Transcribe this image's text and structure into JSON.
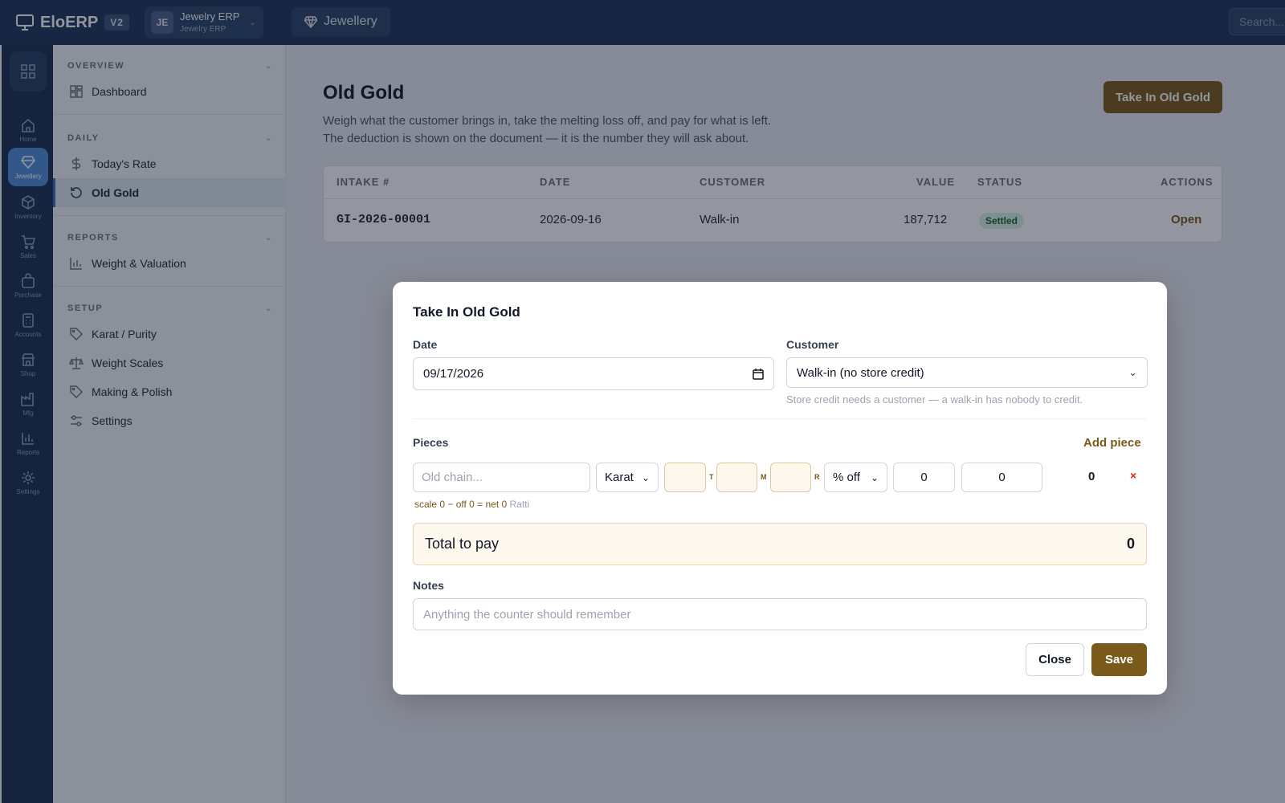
{
  "app": {
    "name": "EloERP",
    "version": "V2"
  },
  "workspace": {
    "initials": "JE",
    "name": "Jewelry ERP",
    "sub": "Jewelry ERP"
  },
  "module": {
    "label": "Jewellery"
  },
  "search": {
    "placeholder": "Search..."
  },
  "rail": {
    "items": [
      {
        "label": "Home",
        "icon": "home-icon"
      },
      {
        "label": "Jewellery",
        "icon": "diamond-icon",
        "active": true
      },
      {
        "label": "Inventory",
        "icon": "box-icon"
      },
      {
        "label": "Sales",
        "icon": "cart-icon"
      },
      {
        "label": "Purchase",
        "icon": "bag-icon"
      },
      {
        "label": "Accounts",
        "icon": "calculator-icon"
      },
      {
        "label": "Shop",
        "icon": "store-icon"
      },
      {
        "label": "Mfg",
        "icon": "factory-icon"
      },
      {
        "label": "Reports",
        "icon": "bar-chart-icon"
      },
      {
        "label": "Settings",
        "icon": "gear-icon"
      }
    ]
  },
  "sidebar": {
    "sections": [
      {
        "title": "OVERVIEW",
        "items": [
          {
            "label": "Dashboard",
            "icon": "dashboard-icon"
          }
        ]
      },
      {
        "title": "DAILY",
        "items": [
          {
            "label": "Today's Rate",
            "icon": "dollar-icon"
          },
          {
            "label": "Old Gold",
            "icon": "history-icon",
            "active": true
          }
        ]
      },
      {
        "title": "REPORTS",
        "items": [
          {
            "label": "Weight & Valuation",
            "icon": "bar-chart-icon"
          }
        ]
      },
      {
        "title": "SETUP",
        "items": [
          {
            "label": "Karat / Purity",
            "icon": "tag-icon"
          },
          {
            "label": "Weight Scales",
            "icon": "scale-icon"
          },
          {
            "label": "Making & Polish",
            "icon": "tag-icon"
          },
          {
            "label": "Settings",
            "icon": "sliders-icon"
          }
        ]
      }
    ]
  },
  "page": {
    "title": "Old Gold",
    "desc_line1": "Weigh what the customer brings in, take the melting loss off, and pay for what is left.",
    "desc_line2": "The deduction is shown on the document — it is the number they will ask about.",
    "primary_action": "Take In Old Gold"
  },
  "table": {
    "columns": [
      "INTAKE #",
      "DATE",
      "CUSTOMER",
      "VALUE",
      "STATUS",
      "ACTIONS"
    ],
    "rows": [
      {
        "intake": "GI-2026-00001",
        "date": "2026-09-16",
        "customer": "Walk-in",
        "value": "187,712",
        "status": "Settled",
        "action": "Open"
      }
    ]
  },
  "modal": {
    "title": "Take In Old Gold",
    "date_label": "Date",
    "date_value": "09/17/2026",
    "customer_label": "Customer",
    "customer_value": "Walk-in (no store credit)",
    "customer_hint": "Store credit needs a customer — a walk-in has nobody to credit.",
    "pieces_label": "Pieces",
    "add_piece": "Add piece",
    "piece": {
      "desc_placeholder": "Old chain...",
      "karat": "Karat",
      "unit_t": "T",
      "unit_m": "M",
      "unit_r": "R",
      "deduction_mode": "% off",
      "deduction_value": "0",
      "rate_value": "0",
      "row_total": "0",
      "remove": "×",
      "scale_text": "scale 0 − off 0 = net 0",
      "scale_unit": "Ratti"
    },
    "total_label": "Total to pay",
    "total_value": "0",
    "notes_label": "Notes",
    "notes_placeholder": "Anything the counter should remember",
    "close": "Close",
    "save": "Save"
  },
  "colors": {
    "topbar": "#1e3558",
    "accent_gold": "#7a5a1a",
    "rail_active": "#4e8fd8",
    "badge_green": "#166534"
  }
}
